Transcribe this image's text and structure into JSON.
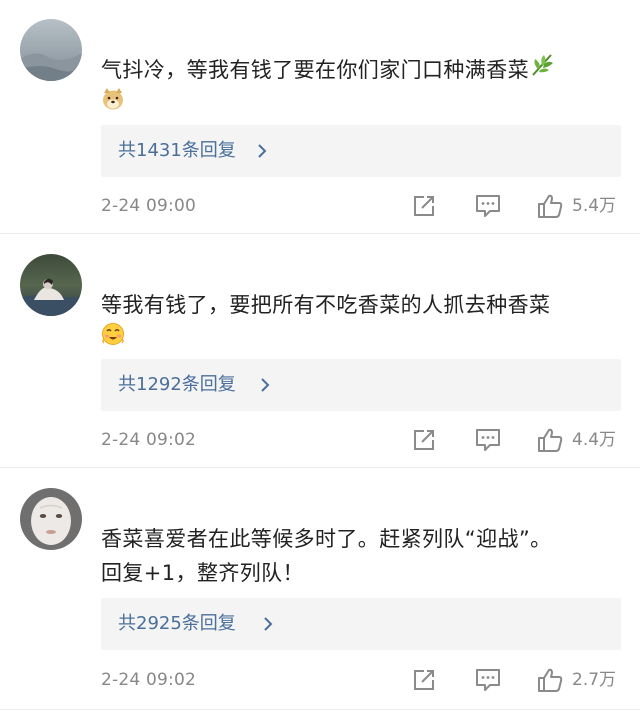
{
  "comments": [
    {
      "avatar": "avatar-misty-landscape",
      "text_line1": "气抖冷，等我有钱了要在你们家门口种满香菜",
      "text_emoji_inline": "herb-emoji",
      "text_line2_emoji": "doge-emoji",
      "replies_label": "共1431条回复",
      "time": "2-24 09:00",
      "likes": "5.4万"
    },
    {
      "avatar": "avatar-person-on-rock",
      "text_line1": "等我有钱了，要把所有不吃香菜的人抓去种香菜",
      "text_line2_emoji": "smiling-blush-emoji",
      "replies_label": "共1292条回复",
      "time": "2-24 09:02",
      "likes": "4.4万"
    },
    {
      "avatar": "avatar-face-mask",
      "text_line1": "香菜喜爱者在此等候多时了。赶紧列队“迎战”。",
      "text_line2": "回复+1，整齐列队！",
      "replies_label": "共2925条回复",
      "time": "2-24 09:02",
      "likes": "2.7万"
    }
  ],
  "colors": {
    "link": "#4a6f9a",
    "meta": "#888888",
    "text": "#222222",
    "reply_bg": "#f4f4f4"
  },
  "icons": {
    "share": "share-icon",
    "comment": "comment-icon",
    "like": "thumbs-up-icon",
    "replies_arrow": "chevron-right-icon"
  }
}
